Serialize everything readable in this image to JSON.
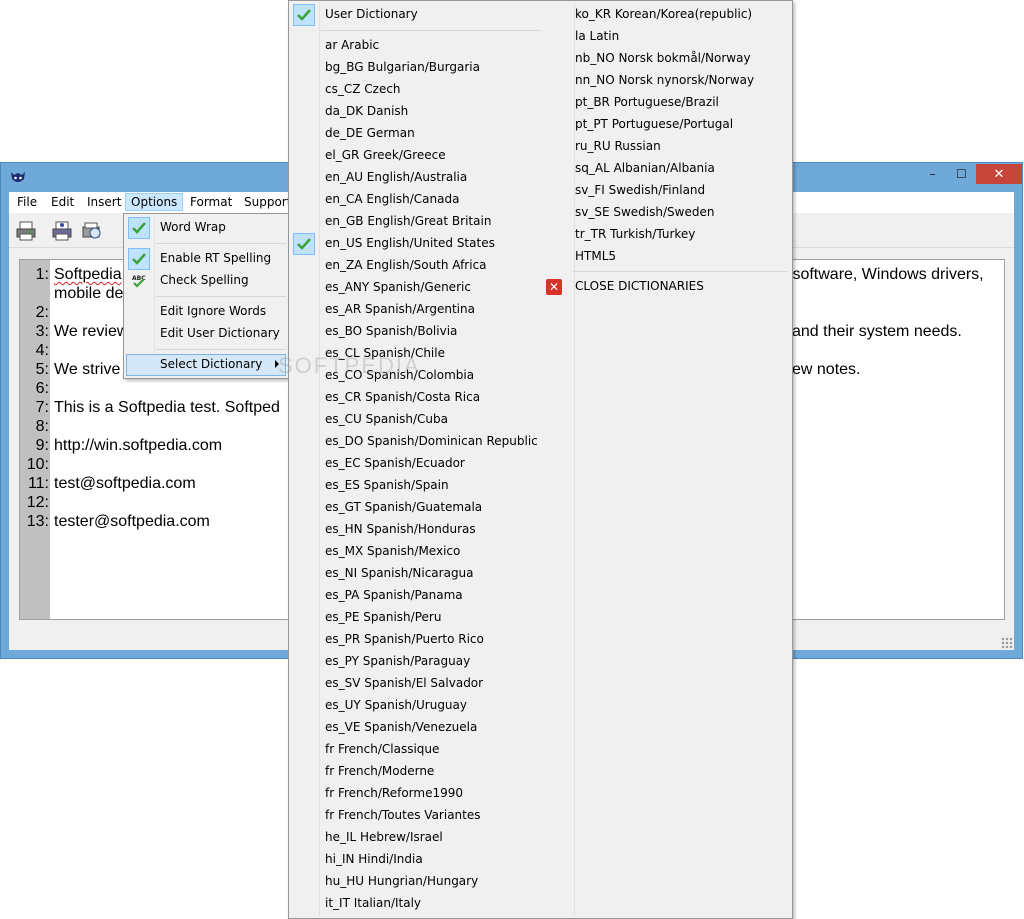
{
  "menubar": {
    "items": [
      "File",
      "Edit",
      "Insert",
      "Options",
      "Format",
      "Support"
    ],
    "active": "Options"
  },
  "window": {
    "minimize": "–",
    "maximize": "☐",
    "close": "✕"
  },
  "editor": {
    "lines": [
      {
        "n": "1:",
        "text": "Softpedia",
        "cont": "mobile de",
        "right": "c software, Windows drivers,"
      },
      {
        "n": "2:",
        "text": ""
      },
      {
        "n": "3:",
        "text": "We review",
        "right": "and their system needs."
      },
      {
        "n": "4:",
        "text": ""
      },
      {
        "n": "5:",
        "text": "We strive",
        "right": "ew notes."
      },
      {
        "n": "6:",
        "text": ""
      },
      {
        "n": "7:",
        "text": "This is a Softpedia test.   Softped"
      },
      {
        "n": "8:",
        "text": ""
      },
      {
        "n": "9:",
        "text": "http://win.softpedia.com"
      },
      {
        "n": "10:",
        "text": ""
      },
      {
        "n": "11:",
        "text": "test@softpedia.com"
      },
      {
        "n": "12:",
        "text": ""
      },
      {
        "n": "13:",
        "text": "tester@softpedia.com"
      }
    ]
  },
  "options_menu": {
    "word_wrap": "Word Wrap",
    "enable_rt_spelling": "Enable RT Spelling",
    "check_spelling": "Check Spelling",
    "edit_ignore_words": "Edit Ignore Words",
    "edit_user_dictionary": "Edit User Dictionary",
    "select_dictionary": "Select Dictionary"
  },
  "dictionary_menu": {
    "user_dictionary": "User Dictionary",
    "col1": [
      "ar Arabic",
      "bg_BG Bulgarian/Burgaria",
      "cs_CZ Czech",
      "da_DK Danish",
      "de_DE German",
      "el_GR Greek/Greece",
      "en_AU English/Australia",
      "en_CA English/Canada",
      "en_GB English/Great Britain",
      "en_US English/United States",
      "en_ZA English/South Africa",
      "es_ANY Spanish/Generic",
      "es_AR Spanish/Argentina",
      "es_BO Spanish/Bolivia",
      "es_CL Spanish/Chile",
      "es_CO Spanish/Colombia",
      "es_CR Spanish/Costa Rica",
      "es_CU Spanish/Cuba",
      "es_DO Spanish/Dominican Republic",
      "es_EC Spanish/Ecuador",
      "es_ES Spanish/Spain",
      "es_GT Spanish/Guatemala",
      "es_HN Spanish/Honduras",
      "es_MX Spanish/Mexico",
      "es_NI Spanish/Nicaragua",
      "es_PA Spanish/Panama",
      "es_PE Spanish/Peru",
      "es_PR Spanish/Puerto Rico",
      "es_PY Spanish/Paraguay",
      "es_SV Spanish/El Salvador",
      "es_UY Spanish/Uruguay",
      "es_VE Spanish/Venezuela",
      "fr French/Classique",
      "fr French/Moderne",
      "fr French/Reforme1990",
      "fr French/Toutes Variantes",
      "he_IL Hebrew/Israel",
      "hi_IN Hindi/India",
      "hu_HU Hungrian/Hungary",
      "it_IT Italian/Italy"
    ],
    "col2": [
      "ko_KR Korean/Korea(republic)",
      "la Latin",
      "nb_NO Norsk bokmål/Norway",
      "nn_NO Norsk nynorsk/Norway",
      "pt_BR Portuguese/Brazil",
      "pt_PT Portuguese/Portugal",
      "ru_RU Russian",
      "sq_AL Albanian/Albania",
      "sv_FI Swedish/Finland",
      "sv_SE Swedish/Sweden",
      "tr_TR Turkish/Turkey",
      "HTML5"
    ],
    "close": "CLOSE DICTIONARIES",
    "checked": [
      "User Dictionary",
      "en_US English/United States"
    ]
  },
  "watermark": "SOFTPEDIA",
  "colors": {
    "check": "#3aa335",
    "close_icon": "#d9322b",
    "selection": "#cce8ff"
  }
}
